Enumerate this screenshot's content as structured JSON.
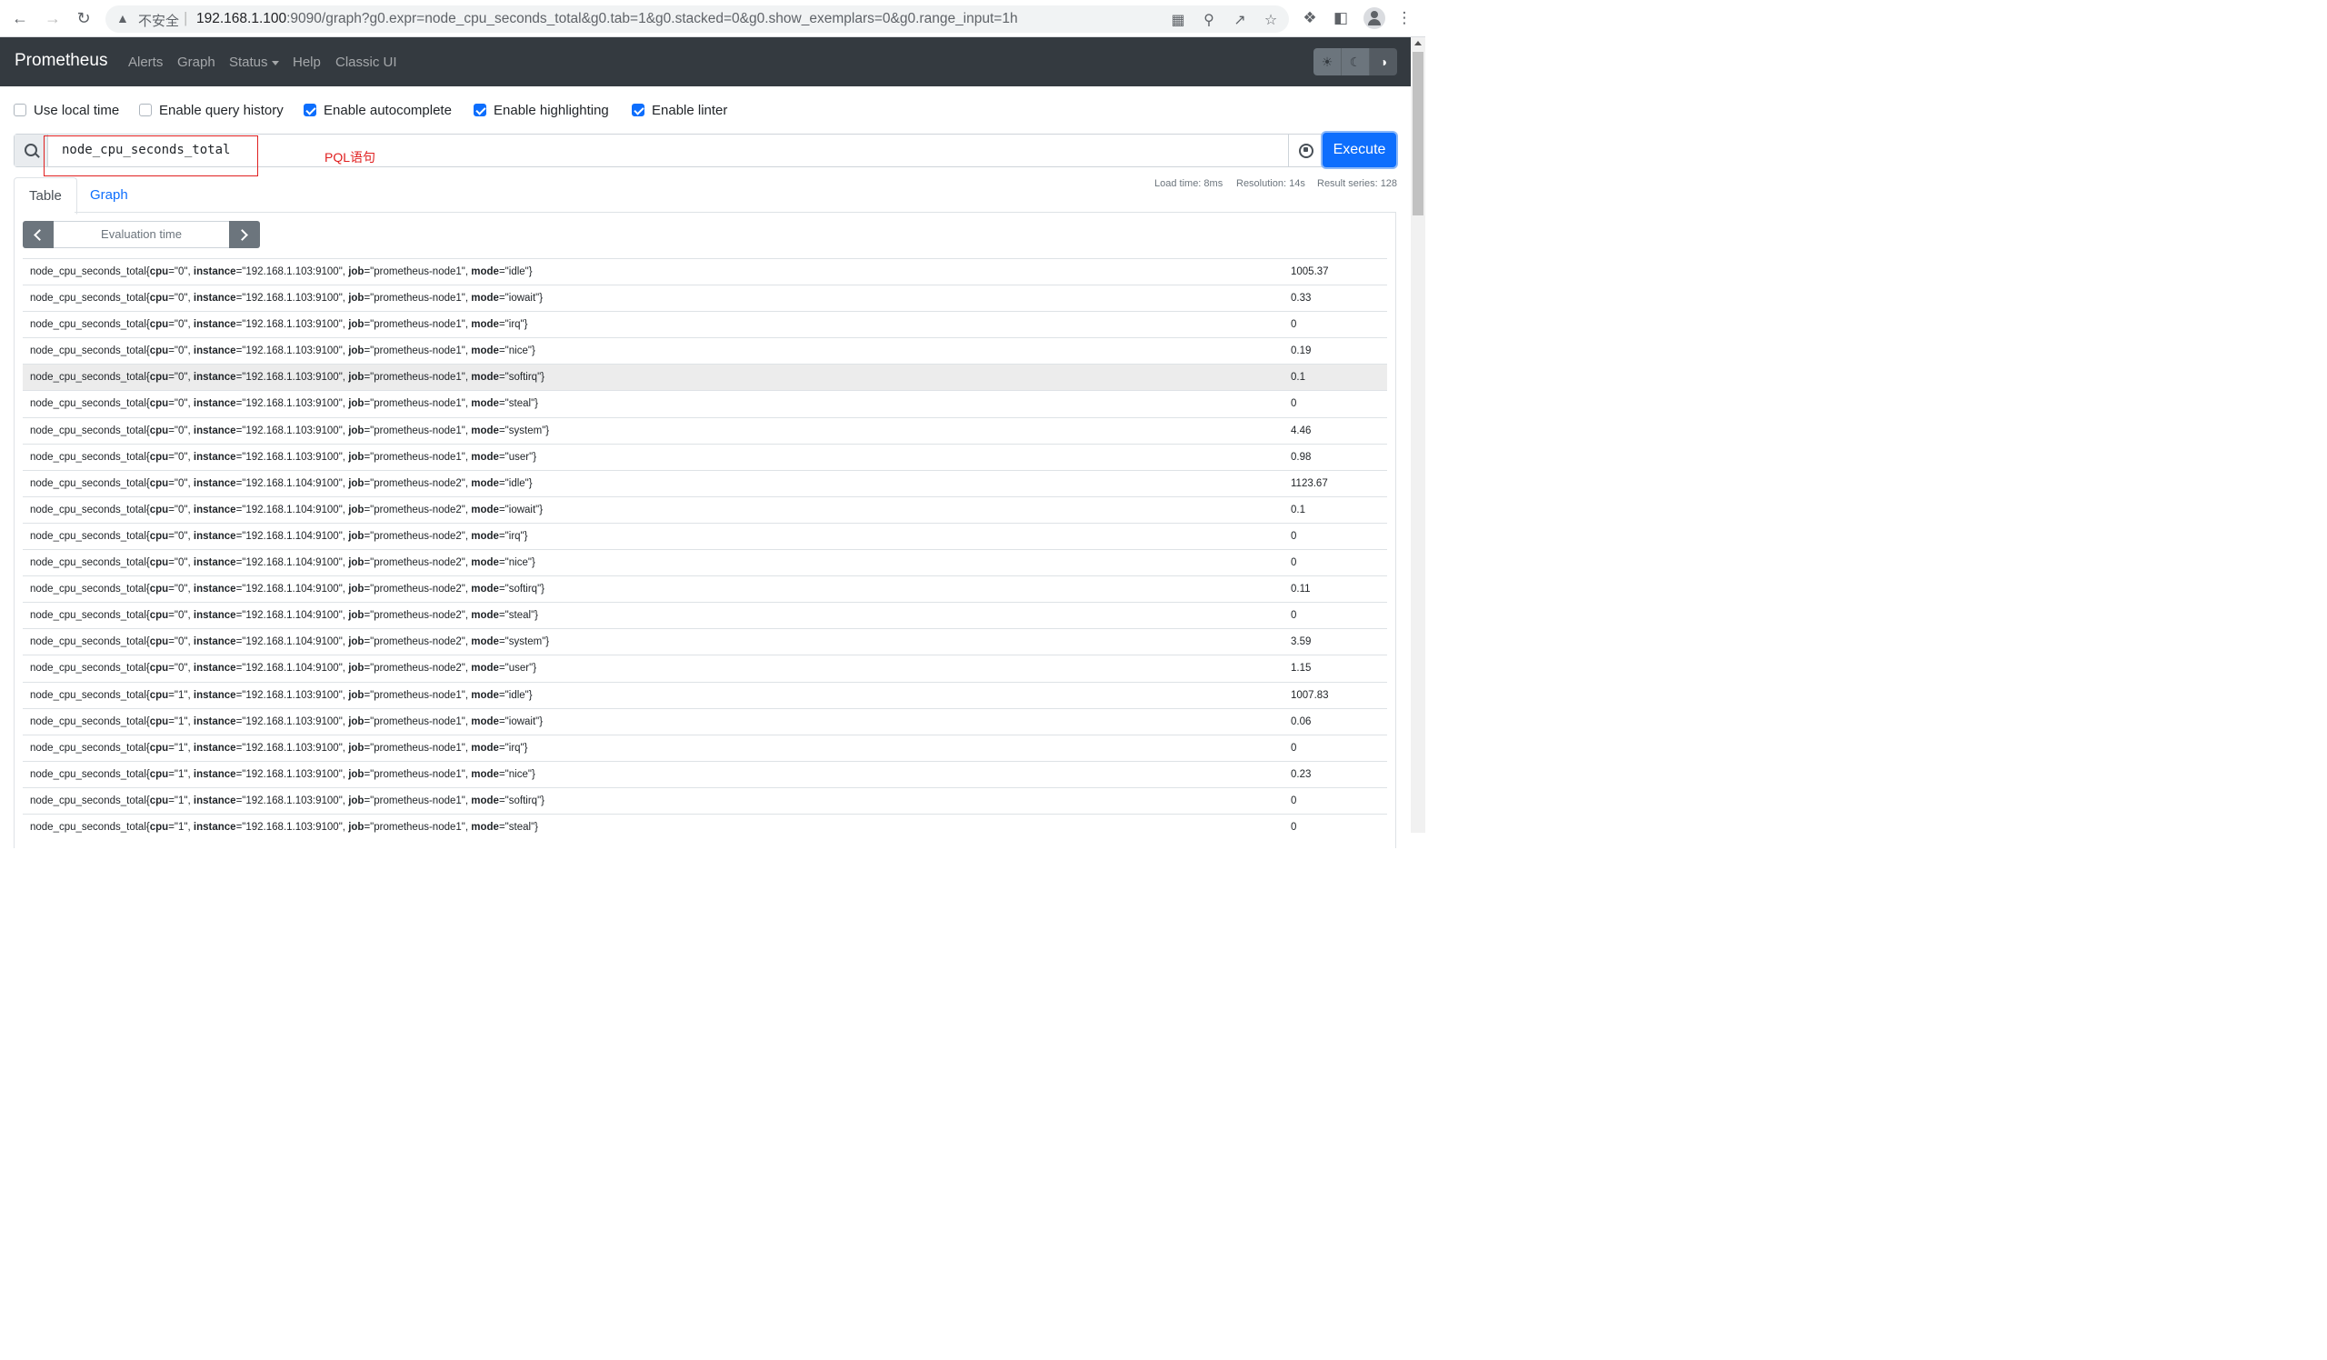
{
  "browser": {
    "insecure_label": "不安全",
    "url_host": "192.168.1.100",
    "url_rest": ":9090/graph?g0.expr=node_cpu_seconds_total&g0.tab=1&g0.stacked=0&g0.show_exemplars=0&g0.range_input=1h"
  },
  "navbar": {
    "brand": "Prometheus",
    "links": [
      "Alerts",
      "Graph",
      "Status",
      "Help",
      "Classic UI"
    ]
  },
  "options": [
    {
      "label": "Use local time",
      "checked": false
    },
    {
      "label": "Enable query history",
      "checked": false
    },
    {
      "label": "Enable autocomplete",
      "checked": true
    },
    {
      "label": "Enable highlighting",
      "checked": true
    },
    {
      "label": "Enable linter",
      "checked": true
    }
  ],
  "query": {
    "expr": "node_cpu_seconds_total",
    "execute_label": "Execute",
    "annotation": "PQL语句"
  },
  "tabs": {
    "table": "Table",
    "graph": "Graph"
  },
  "meta": {
    "load_time": "Load time: 8ms",
    "resolution": "Resolution: 14s",
    "result_series": "Result series: 128"
  },
  "eval": {
    "placeholder": "Evaluation time"
  },
  "metric_name": "node_cpu_seconds_total",
  "results": [
    {
      "cpu": "0",
      "instance": "192.168.1.103:9100",
      "job": "prometheus-node1",
      "mode": "idle",
      "value": "1005.37"
    },
    {
      "cpu": "0",
      "instance": "192.168.1.103:9100",
      "job": "prometheus-node1",
      "mode": "iowait",
      "value": "0.33"
    },
    {
      "cpu": "0",
      "instance": "192.168.1.103:9100",
      "job": "prometheus-node1",
      "mode": "irq",
      "value": "0"
    },
    {
      "cpu": "0",
      "instance": "192.168.1.103:9100",
      "job": "prometheus-node1",
      "mode": "nice",
      "value": "0.19"
    },
    {
      "cpu": "0",
      "instance": "192.168.1.103:9100",
      "job": "prometheus-node1",
      "mode": "softirq",
      "value": "0.1"
    },
    {
      "cpu": "0",
      "instance": "192.168.1.103:9100",
      "job": "prometheus-node1",
      "mode": "steal",
      "value": "0"
    },
    {
      "cpu": "0",
      "instance": "192.168.1.103:9100",
      "job": "prometheus-node1",
      "mode": "system",
      "value": "4.46"
    },
    {
      "cpu": "0",
      "instance": "192.168.1.103:9100",
      "job": "prometheus-node1",
      "mode": "user",
      "value": "0.98"
    },
    {
      "cpu": "0",
      "instance": "192.168.1.104:9100",
      "job": "prometheus-node2",
      "mode": "idle",
      "value": "1123.67"
    },
    {
      "cpu": "0",
      "instance": "192.168.1.104:9100",
      "job": "prometheus-node2",
      "mode": "iowait",
      "value": "0.1"
    },
    {
      "cpu": "0",
      "instance": "192.168.1.104:9100",
      "job": "prometheus-node2",
      "mode": "irq",
      "value": "0"
    },
    {
      "cpu": "0",
      "instance": "192.168.1.104:9100",
      "job": "prometheus-node2",
      "mode": "nice",
      "value": "0"
    },
    {
      "cpu": "0",
      "instance": "192.168.1.104:9100",
      "job": "prometheus-node2",
      "mode": "softirq",
      "value": "0.11"
    },
    {
      "cpu": "0",
      "instance": "192.168.1.104:9100",
      "job": "prometheus-node2",
      "mode": "steal",
      "value": "0"
    },
    {
      "cpu": "0",
      "instance": "192.168.1.104:9100",
      "job": "prometheus-node2",
      "mode": "system",
      "value": "3.59"
    },
    {
      "cpu": "0",
      "instance": "192.168.1.104:9100",
      "job": "prometheus-node2",
      "mode": "user",
      "value": "1.15"
    },
    {
      "cpu": "1",
      "instance": "192.168.1.103:9100",
      "job": "prometheus-node1",
      "mode": "idle",
      "value": "1007.83"
    },
    {
      "cpu": "1",
      "instance": "192.168.1.103:9100",
      "job": "prometheus-node1",
      "mode": "iowait",
      "value": "0.06"
    },
    {
      "cpu": "1",
      "instance": "192.168.1.103:9100",
      "job": "prometheus-node1",
      "mode": "irq",
      "value": "0"
    },
    {
      "cpu": "1",
      "instance": "192.168.1.103:9100",
      "job": "prometheus-node1",
      "mode": "nice",
      "value": "0.23"
    },
    {
      "cpu": "1",
      "instance": "192.168.1.103:9100",
      "job": "prometheus-node1",
      "mode": "softirq",
      "value": "0"
    },
    {
      "cpu": "1",
      "instance": "192.168.1.103:9100",
      "job": "prometheus-node1",
      "mode": "steal",
      "value": "0"
    }
  ],
  "colors": {
    "navbar": "#343a40",
    "primary": "#0d6efd",
    "annotation": "#e02020"
  }
}
